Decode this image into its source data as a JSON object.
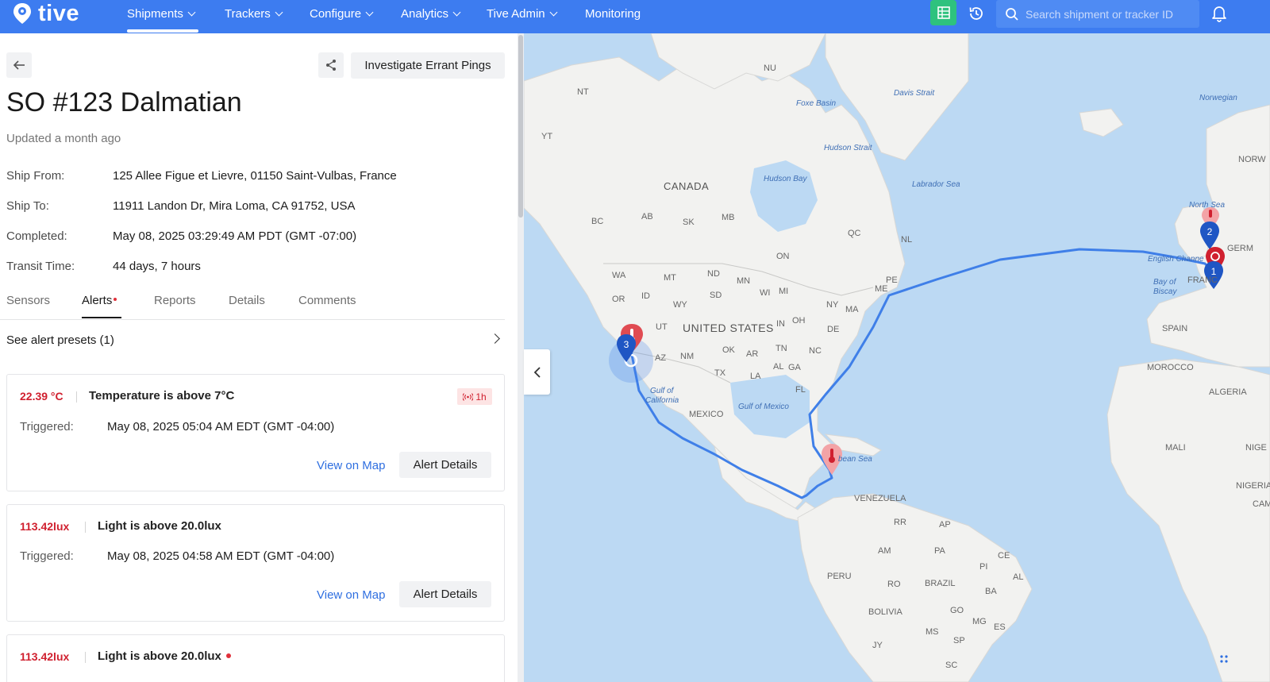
{
  "brand": {
    "name": "tive"
  },
  "nav": {
    "items": [
      {
        "label": "Shipments"
      },
      {
        "label": "Trackers"
      },
      {
        "label": "Configure"
      },
      {
        "label": "Analytics"
      },
      {
        "label": "Tive Admin"
      },
      {
        "label": "Monitoring"
      }
    ],
    "search_placeholder": "Search shipment or tracker ID"
  },
  "toolbar": {
    "investigate_label": "Investigate Errant Pings"
  },
  "shipment": {
    "title": "SO #123 Dalmatian",
    "updated": "Updated a month ago",
    "fields": [
      {
        "label": "Ship From:",
        "value": "125 Allee Figue et Lievre, 01150 Saint-Vulbas, France"
      },
      {
        "label": "Ship To:",
        "value": "11911 Landon Dr, Mira Loma, CA 91752, USA"
      },
      {
        "label": "Completed:",
        "value": "May 08, 2025 03:29:49 AM PDT (GMT -07:00)"
      },
      {
        "label": "Transit Time:",
        "value": "44 days, 7 hours"
      }
    ]
  },
  "tabs": [
    {
      "label": "Sensors"
    },
    {
      "label": "Alerts"
    },
    {
      "label": "Reports"
    },
    {
      "label": "Details"
    },
    {
      "label": "Comments"
    }
  ],
  "presets": {
    "label": "See alert presets (1)"
  },
  "alerts": [
    {
      "value": "22.39 °C",
      "text": "Temperature is above 7°C",
      "triggered_label": "Triggered:",
      "triggered": "May 08, 2025 05:04 AM EDT (GMT -04:00)",
      "badge": "1h",
      "view_map": "View on Map",
      "details": "Alert Details"
    },
    {
      "value": "113.42lux",
      "text": "Light is above 20.0lux",
      "triggered_label": "Triggered:",
      "triggered": "May 08, 2025 04:58 AM EDT (GMT -04:00)",
      "view_map": "View on Map",
      "details": "Alert Details"
    },
    {
      "value": "113.42lux",
      "text": "Light is above 20.0lux"
    }
  ],
  "map": {
    "labels": {
      "canada": "CANADA",
      "us": "UNITED STATES",
      "mexico": "MEXICO",
      "venezuela": "VENEZUELA",
      "peru": "PERU",
      "brazil": "BRAZIL",
      "bolivia": "BOLIVIA",
      "spain": "SPAIN",
      "morocco": "MOROCCO",
      "algeria": "ALGERIA",
      "mali": "MALI",
      "nige": "NIGE",
      "nigeria": "NIGERIA",
      "france": "FRANC",
      "germ": "GERM",
      "norw": "NORW",
      "cam": "CAM",
      "hudson_bay": "Hudson Bay",
      "hudson_strait": "Hudson Strait",
      "labrador": "Labrador Sea",
      "foxe": "Foxe Basin",
      "davis": "Davis Strait",
      "norwegian": "Norwegian",
      "north_sea": "North Sea",
      "english": "English Channe",
      "biscay1": "Bay of",
      "biscay2": "Biscay",
      "gulf_mexico": "Gulf of Mexico",
      "gulf_cal1": "Gulf of",
      "gulf_cal2": "California",
      "caribbean": "bean Sea",
      "nt": "NT",
      "nu": "NU",
      "yt": "YT",
      "bc": "BC",
      "ab": "AB",
      "sk": "SK",
      "mb": "MB",
      "on": "ON",
      "qc": "QC",
      "nl": "NL",
      "pe": "PE",
      "wa": "WA",
      "or": "OR",
      "id": "ID",
      "mt": "MT",
      "wy": "WY",
      "ut": "UT",
      "az": "AZ",
      "nm": "NM",
      "nd": "ND",
      "sd": "SD",
      "mn": "MN",
      "wi": "WI",
      "mi": "MI",
      "ok": "OK",
      "tx": "TX",
      "ar": "AR",
      "la": "LA",
      "in": "IN",
      "oh": "OH",
      "tn": "TN",
      "al": "AL",
      "ga": "GA",
      "nc": "NC",
      "fl": "FL",
      "ny": "NY",
      "ma": "MA",
      "me": "ME",
      "de": "DE",
      "rr": "RR",
      "ap": "AP",
      "am": "AM",
      "pa": "PA",
      "ce": "CE",
      "pi": "PI",
      "al2": "AL",
      "ro": "RO",
      "ba": "BA",
      "go": "GO",
      "mg": "MG",
      "ms": "MS",
      "sp": "SP",
      "es": "ES",
      "sc": "SC",
      "jy": "JY"
    },
    "pins": {
      "p1": "1",
      "p2": "2",
      "p3": "3"
    },
    "colors": {
      "route": "#3f7fe8",
      "pin_blue": "#1f56c4",
      "pin_red": "#e04b52",
      "pin_red_light": "#f3a3a6",
      "water": "#bcd9f3",
      "land": "#f2f2f0"
    }
  }
}
